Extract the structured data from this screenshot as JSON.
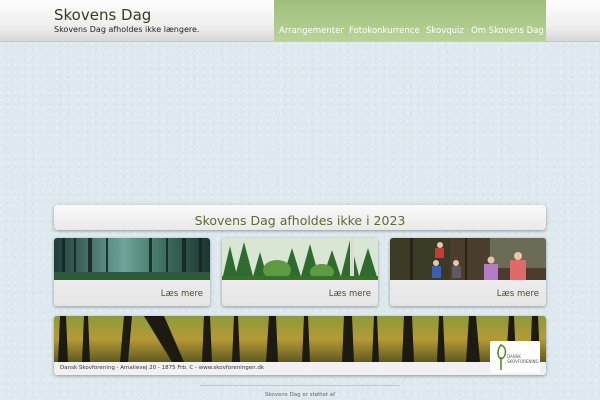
{
  "header": {
    "site_title": "Skovens Dag",
    "tagline": "Skovens Dag afholdes ikke længere."
  },
  "nav": {
    "items": [
      "Arrangementer",
      "Fotokonkurrence",
      "Skovquiz",
      "Om Skovens Dag"
    ]
  },
  "banner": {
    "heading": "Skovens Dag afholdes ikke i 2023"
  },
  "cards": [
    {
      "link": "Læs mere",
      "image": "misty-forest-photo"
    },
    {
      "link": "Læs mere",
      "image": "green-forest-photo"
    },
    {
      "link": "Læs mere",
      "image": "people-in-forest-photo"
    }
  ],
  "footer": {
    "address": "Dansk Skovforening - Amalievej 20 - 1875 Frb. C - www.skovforeningen.dk",
    "logo_text": "DANSK SKOVFORENING",
    "support": "Skovens Dag er støttet af"
  },
  "colors": {
    "nav_green": "#a9c788",
    "heading_green": "#5a6b33",
    "page_background": "#dde9ee"
  }
}
